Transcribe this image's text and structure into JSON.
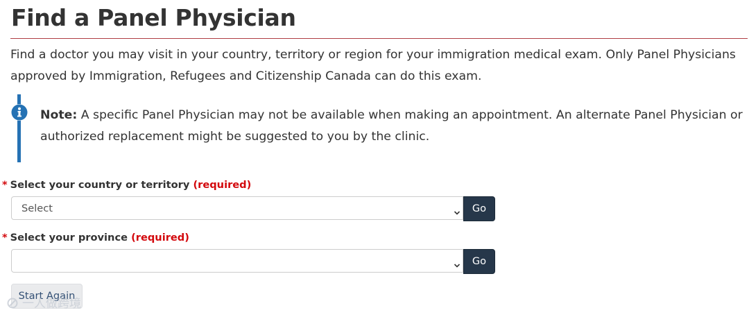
{
  "page": {
    "title": "Find a Panel Physician",
    "intro": "Find a doctor you may visit in your country, territory or region for your immigration medical exam. Only Panel Physicians approved by Immigration, Refugees and Citizenship Canada can do this exam."
  },
  "alert": {
    "icon": "info-icon",
    "label": "Note:",
    "text": "A specific Panel Physician may not be available when making an appointment. An alternate Panel Physician or authorized replacement might be suggested to you by the clinic."
  },
  "form": {
    "country": {
      "required_marker": "*",
      "label": "Select your country or territory",
      "required_text": "(required)",
      "selected": "Select",
      "go_label": "Go"
    },
    "province": {
      "required_marker": "*",
      "label": "Select your province",
      "required_text": "(required)",
      "selected": "",
      "go_label": "Go"
    },
    "start_again_label": "Start Again"
  },
  "watermark": {
    "text": "一人做跨境"
  },
  "colors": {
    "title_rule": "#af3c43",
    "alert_bar": "#2572b4",
    "required": "#d3080c",
    "go_button": "#26374a",
    "start_again_bg": "#eaebed"
  }
}
